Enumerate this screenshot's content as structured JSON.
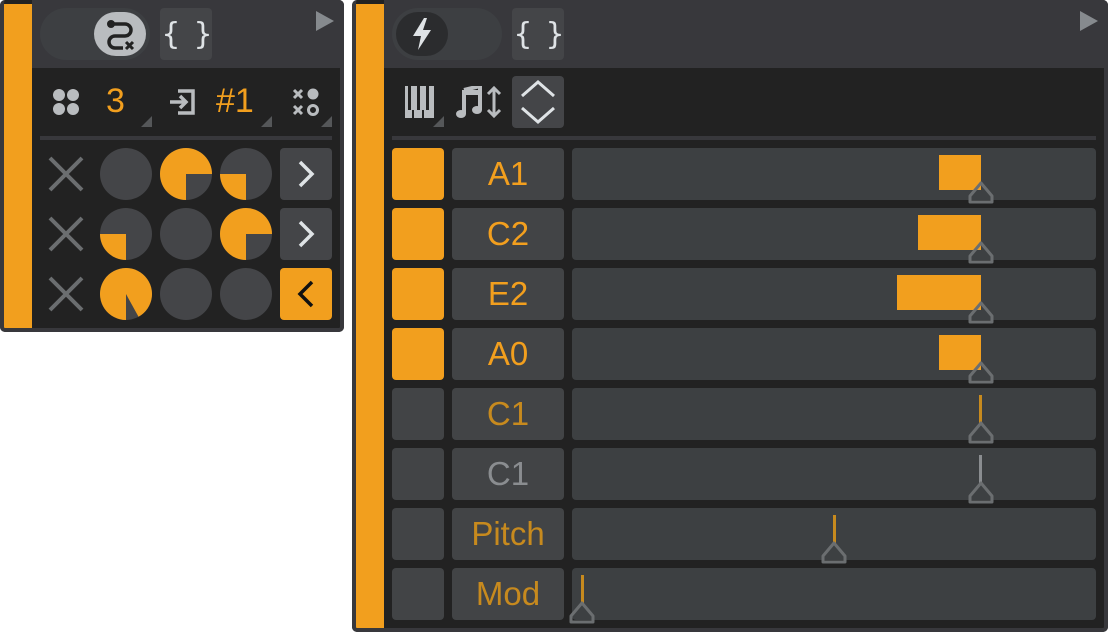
{
  "colors": {
    "accent": "#F29F1E",
    "dim_accent": "#C78A1E",
    "inactive": "#8a8d90"
  },
  "left_device": {
    "route_toggle_icon": "route-x-icon",
    "brace_label": "{ }",
    "toolbar": {
      "grid_icon": "four-dots-icon",
      "count_value": "3",
      "input_icon": "input-arrow-icon",
      "channel_value": "#1",
      "pattern_icon": "x-o-pattern-icon"
    },
    "rows": [
      {
        "pies": [
          0,
          0.75,
          0.25
        ],
        "nav": "next",
        "nav_active": false
      },
      {
        "pies": [
          0.25,
          0,
          0.75
        ],
        "nav": "next",
        "nav_active": false
      },
      {
        "pies": [
          0.92,
          0,
          0
        ],
        "nav": "prev",
        "nav_active": true
      }
    ]
  },
  "right_device": {
    "power_icon": "lightning-icon",
    "brace_label": "{ }",
    "toolbar": {
      "piano_icon": "piano-keys-icon",
      "note_icon": "note-updown-icon",
      "updown_icon": "chevron-up-down-icon"
    },
    "rows": [
      {
        "label": "A1",
        "active": true,
        "label_color": "accent",
        "value": 0.78,
        "bar_from": 0.7
      },
      {
        "label": "C2",
        "active": true,
        "label_color": "accent",
        "value": 0.78,
        "bar_from": 0.66
      },
      {
        "label": "E2",
        "active": true,
        "label_color": "accent",
        "value": 0.78,
        "bar_from": 0.62
      },
      {
        "label": "A0",
        "active": true,
        "label_color": "accent",
        "value": 0.78,
        "bar_from": 0.7
      },
      {
        "label": "C1",
        "active": false,
        "label_color": "dim_accent",
        "value": 0.78,
        "line": "dim_accent"
      },
      {
        "label": "C1",
        "active": false,
        "label_color": "inactive",
        "value": 0.78,
        "line": "inactive"
      },
      {
        "label": "Pitch",
        "active": false,
        "label_color": "dim_accent",
        "value": 0.5,
        "line": "dim_accent"
      },
      {
        "label": "Mod",
        "active": false,
        "label_color": "dim_accent",
        "value": 0.02,
        "line": "dim_accent"
      }
    ]
  }
}
